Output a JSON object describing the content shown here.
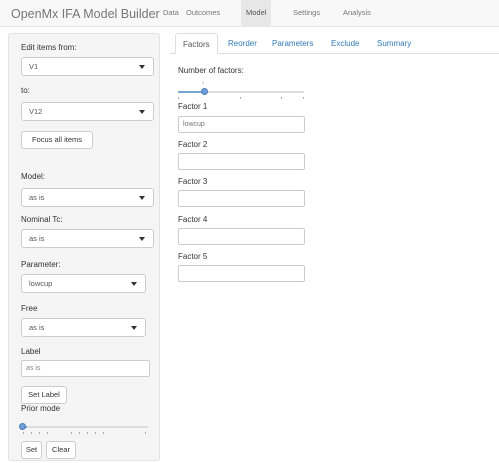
{
  "navbar": {
    "brand": "OpenMx IFA Model Builder",
    "tabs": [
      {
        "label": "Data",
        "active": false
      },
      {
        "label": "Outcomes",
        "active": false
      },
      {
        "label": "Model",
        "active": true
      },
      {
        "label": "Settings",
        "active": false
      },
      {
        "label": "Analysis",
        "active": false
      }
    ]
  },
  "sidebar": {
    "edit_from_label": "Edit items from:",
    "edit_from_value": "V1",
    "to_label": "to:",
    "to_value": "V12",
    "focus_button": "Focus all items",
    "model_label": "Model:",
    "model_value": "as is",
    "nominal_label": "Nominal Tc:",
    "nominal_value": "as is",
    "parameter_label": "Parameter:",
    "parameter_value": "lowcup",
    "free_label": "Free",
    "free_value": "as is",
    "label_label": "Label",
    "label_input_value": "as is",
    "set_label_button": "Set Label",
    "prior_mode_label": "Prior mode",
    "set_button": "Set",
    "clear_button": "Clear"
  },
  "main": {
    "tabs": [
      {
        "label": "Factors",
        "active": true
      },
      {
        "label": "Reorder",
        "active": false
      },
      {
        "label": "Parameters",
        "active": false
      },
      {
        "label": "Exclude",
        "active": false
      },
      {
        "label": "Summary",
        "active": false
      }
    ],
    "num_factors_label": "Number of factors:",
    "num_factors_value": 1,
    "factors": [
      {
        "label": "Factor 1",
        "value": "lowcup"
      },
      {
        "label": "Factor 2",
        "value": ""
      },
      {
        "label": "Factor 3",
        "value": ""
      },
      {
        "label": "Factor 4",
        "value": ""
      },
      {
        "label": "Factor 5",
        "value": ""
      }
    ]
  },
  "colors": {
    "accent": "#337ab7",
    "slider": "#6e9fd8"
  }
}
